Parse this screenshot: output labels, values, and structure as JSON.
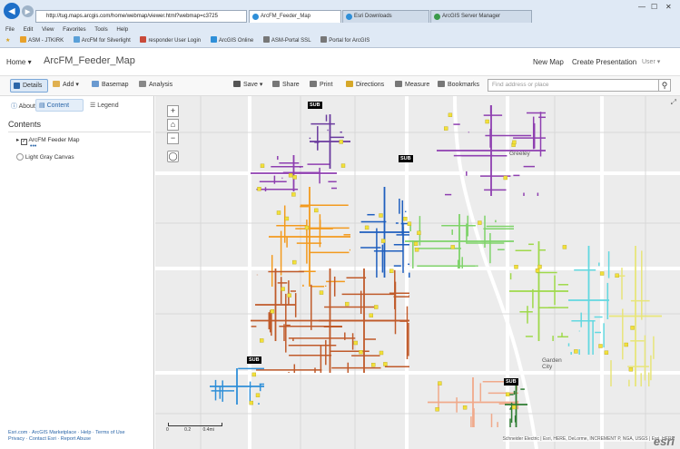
{
  "browser": {
    "url": "http://tug.maps.arcgis.com/home/webmap/viewer.html?webmap=c3725",
    "tabs": [
      "ArcFM_Feeder_Map",
      "Esri Downloads",
      "ArcGIS Server Manager"
    ],
    "menu": [
      "File",
      "Edit",
      "View",
      "Favorites",
      "Tools",
      "Help"
    ],
    "favorites": [
      "ASM - JTKIRK",
      "ArcFM for Silverlight",
      "responder User Login",
      "ArcGIS Online",
      "ASM-Portal SSL",
      "Portal for ArcGIS"
    ]
  },
  "header": {
    "home": "Home ▾",
    "title": "ArcFM_Feeder_Map",
    "new_map": "New Map",
    "create_presentation": "Create Presentation",
    "user": "User ▾"
  },
  "toolbar": {
    "details": "Details",
    "add": "Add ▾",
    "basemap": "Basemap",
    "analysis": "Analysis",
    "save": "Save ▾",
    "share": "Share",
    "print": "Print",
    "directions": "Directions",
    "measure": "Measure",
    "bookmarks": "Bookmarks",
    "search_placeholder": "Find address or place"
  },
  "sidebar": {
    "tabs": [
      "About",
      "Content",
      "Legend"
    ],
    "contents_title": "Contents",
    "layers": [
      "ArcFM Feeder Map",
      "Light Gray Canvas"
    ],
    "footer_line1": "Esri.com · ArcGIS Marketplace · Help · Terms of Use",
    "footer_line2": "Privacy · Contact Esri · Report Abuse"
  },
  "map": {
    "labels": [
      "Greeley",
      "Garden City"
    ],
    "substations": [
      "SUB",
      "SUB",
      "SUB",
      "SUB"
    ],
    "scale_labels": [
      "0",
      "0.2",
      "0.4mi"
    ],
    "attribution": "Schneider Electric | Esri, HERE, DeLorme, INCREMENT P, NGA, USGS | Esri, HERE",
    "logo": "esri",
    "feeder_colors": [
      "#8e3fb0",
      "#6a3a9e",
      "#1f5fbf",
      "#f39a1e",
      "#c05a2a",
      "#7fd36a",
      "#9fd94a",
      "#62d8e0",
      "#e8e57a",
      "#2f8fd8",
      "#f0a98a",
      "#2e7d32"
    ]
  }
}
